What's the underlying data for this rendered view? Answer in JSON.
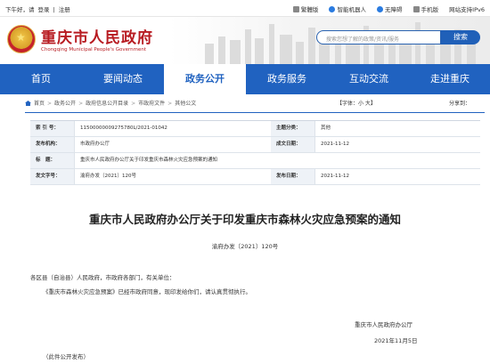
{
  "topbar": {
    "greeting": "下午好，请",
    "login": "登录",
    "register": "注册",
    "links": [
      "繁體版",
      "智能机器人",
      "无障碍",
      "手机版",
      "网站支持IPv6"
    ]
  },
  "header": {
    "title": "重庆市人民政府",
    "subtitle": "Chongqing Municipal People's Government",
    "search_placeholder": "搜索您想了解的政策/资讯/服务",
    "search_button": "搜索"
  },
  "nav": {
    "items": [
      "首页",
      "要闻动态",
      "政务公开",
      "政务服务",
      "互动交流",
      "走进重庆"
    ],
    "active_index": 2
  },
  "breadcrumb": {
    "items": [
      "首页",
      "政务公开",
      "政府信息公开目录",
      "市政府文件",
      "其他公文"
    ],
    "font_label": "【字体：小 大】",
    "share_label": "分享到："
  },
  "info_table": {
    "index_label": "索 引 号：",
    "index_value": "11500000009275780L/2021-01042",
    "subject_label": "主题分类：",
    "subject_value": "其他",
    "publisher_label": "发布机构：",
    "publisher_value": "市政府办公厅",
    "created_label": "成文日期：",
    "created_value": "2021-11-12",
    "title_label": "标　题：",
    "title_value": "重庆市人民政府办公厅关于印发重庆市森林火灾应急预案的通知",
    "docno_label": "发文字号：",
    "docno_value": "渝府办发〔2021〕120号",
    "pubdate_label": "发布日期：",
    "pubdate_value": "2021-11-12"
  },
  "article": {
    "title": "重庆市人民政府办公厅关于印发重庆市森林火灾应急预案的通知",
    "doc_number": "渝府办发〔2021〕120号",
    "salutation": "各区县（自治县）人民政府，市政府各部门，有关单位：",
    "body": "《重庆市森林火灾应急预案》已经市政府同意，现印发给你们，请认真贯彻执行。",
    "signer": "重庆市人民政府办公厅",
    "date": "2021年11月5日",
    "note": "（此件公开发布）"
  },
  "colors": {
    "brand_red": "#b81c22",
    "nav_blue": "#2062c0"
  }
}
